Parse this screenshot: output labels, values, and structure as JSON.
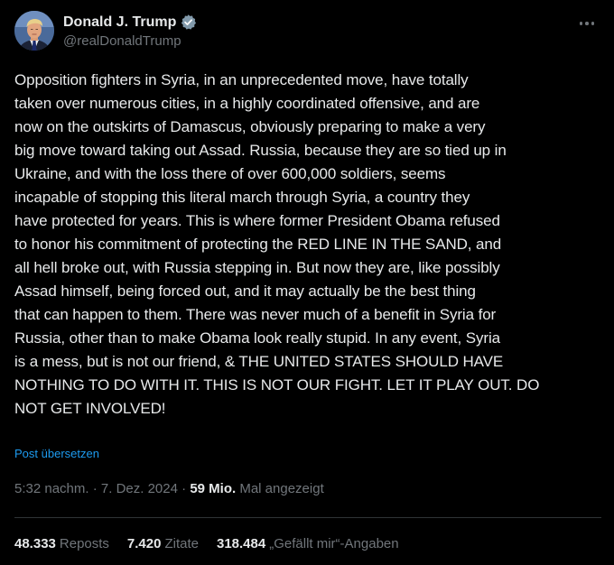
{
  "author": {
    "display_name": "Donald J. Trump",
    "handle": "@realDonaldTrump",
    "verified_icon": "verified-badge-icon",
    "verified_color": "#829aab"
  },
  "post": {
    "text": "Opposition fighters in Syria, in an unprecedented move, have totally\ntaken over numerous cities, in a highly coordinated offensive, and are\nnow on the outskirts of Damascus, obviously preparing to make a very\nbig move toward taking out Assad. Russia, because they are so tied up in\nUkraine, and with the loss there of over 600,000 soldiers, seems\nincapable of stopping this literal march through Syria, a country they\nhave protected for years. This is where former President Obama refused\nto honor his commitment of protecting the RED LINE IN THE SAND, and\nall hell broke out, with Russia stepping in. But now they are, like possibly\nAssad himself, being forced out, and it may actually be the best thing\nthat can happen to them. There was never much of a benefit in Syria for\nRussia, other than to make Obama look really stupid. In any event, Syria\nis a mess, but is not our friend, & THE UNITED STATES SHOULD HAVE\nNOTHING TO DO WITH IT. THIS IS NOT OUR FIGHT. LET IT PLAY OUT. DO\nNOT GET INVOLVED!",
    "translate_label": "Post übersetzen"
  },
  "meta": {
    "time": "5:32 nachm.",
    "separator": " · ",
    "date": "7. Dez. 2024",
    "separator2": " · ",
    "views_count": "59 Mio.",
    "views_label": " Mal angezeigt"
  },
  "stats": {
    "reposts_count": "48.333",
    "reposts_label": "Reposts",
    "quotes_count": "7.420",
    "quotes_label": "Zitate",
    "likes_count": "318.484",
    "likes_label": "„Gefällt mir“-Angaben"
  },
  "colors": {
    "background": "#000000",
    "text": "#e7e9ea",
    "secondary": "#71767b",
    "link": "#1d9bf0",
    "divider": "#2f3336"
  }
}
